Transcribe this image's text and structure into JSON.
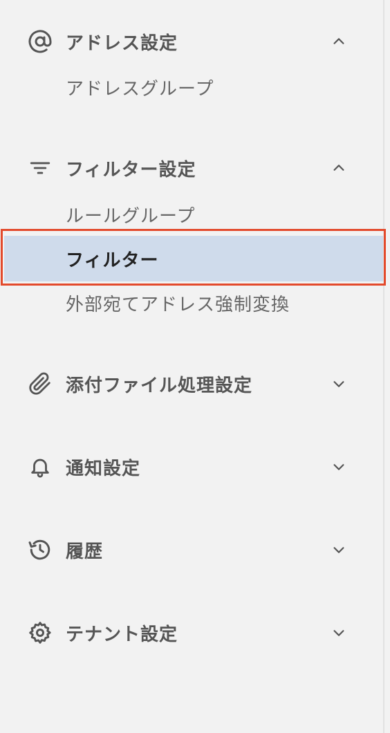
{
  "colors": {
    "background": "#f2f2f2",
    "active_background": "#cfdbeb",
    "highlight_border": "#e34a2c",
    "header_text": "#555555",
    "sub_text": "#666666",
    "active_text": "#222222"
  },
  "nav": {
    "address": {
      "label": "アドレス設定",
      "icon": "at-icon",
      "expanded": true,
      "items": [
        {
          "label": "アドレスグループ"
        }
      ]
    },
    "filter": {
      "label": "フィルター設定",
      "icon": "filter-icon",
      "expanded": true,
      "items": [
        {
          "label": "ルールグループ"
        },
        {
          "label": "フィルター",
          "active": true
        },
        {
          "label": "外部宛てアドレス強制変換"
        }
      ]
    },
    "attachment": {
      "label": "添付ファイル処理設定",
      "icon": "paperclip-icon",
      "expanded": false
    },
    "notification": {
      "label": "通知設定",
      "icon": "bell-icon",
      "expanded": false
    },
    "history": {
      "label": "履歴",
      "icon": "history-icon",
      "expanded": false
    },
    "tenant": {
      "label": "テナント設定",
      "icon": "gear-icon",
      "expanded": false
    }
  }
}
